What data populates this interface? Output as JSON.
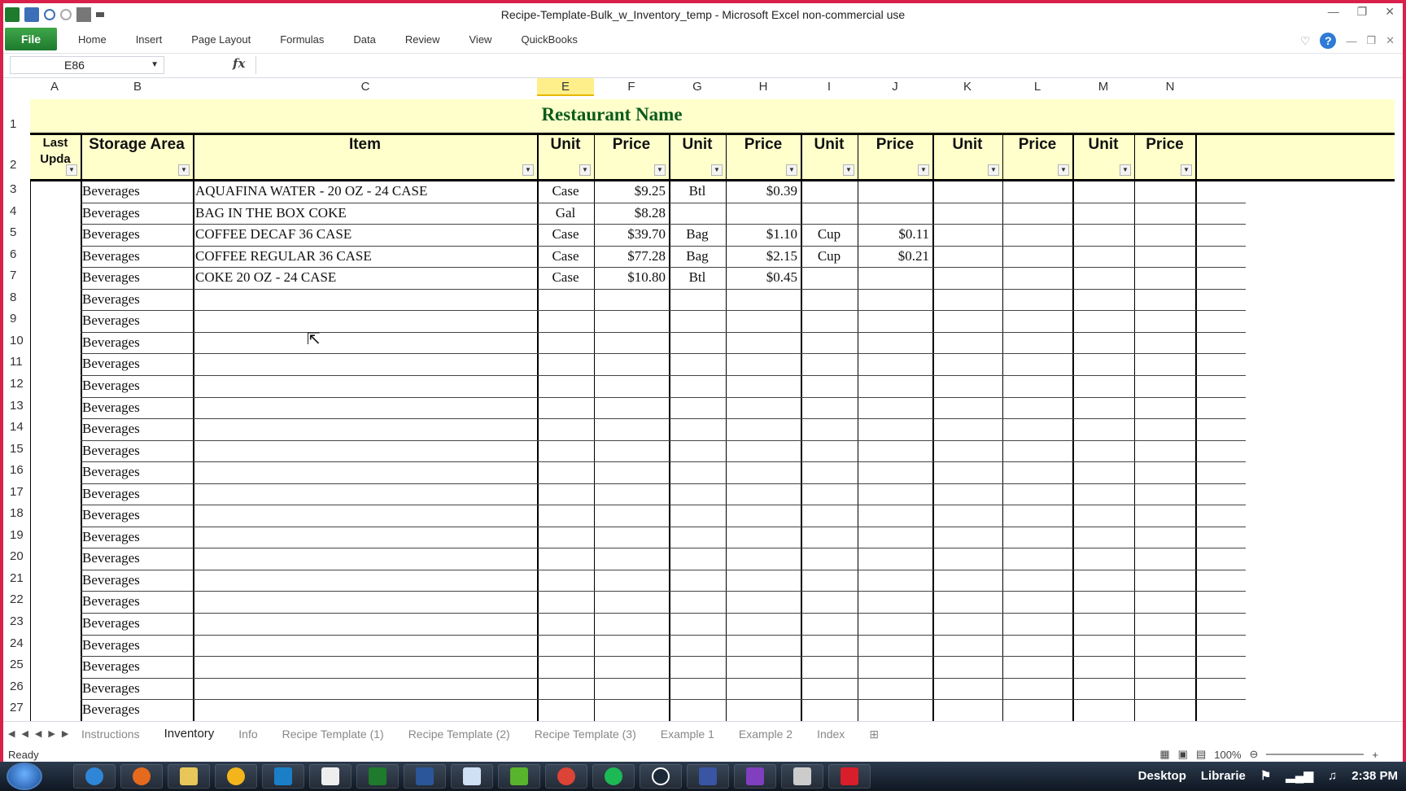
{
  "window": {
    "title": "Recipe-Template-Bulk_w_Inventory_temp  -  Microsoft Excel non-commercial use"
  },
  "ribbon": {
    "file_label": "File",
    "tabs": [
      "Home",
      "Insert",
      "Page Layout",
      "Formulas",
      "Data",
      "Review",
      "View",
      "QuickBooks"
    ]
  },
  "formula_bar": {
    "name_box": "E86",
    "fx_label": "fx",
    "value": ""
  },
  "columns": [
    "A",
    "B",
    "C",
    "E",
    "F",
    "G",
    "H",
    "I",
    "J",
    "K",
    "L",
    "M",
    "N"
  ],
  "selected_column": "E",
  "sheet": {
    "title": "Restaurant Name",
    "headers": {
      "last_update": "Last Upda",
      "storage_area": "Storage Area",
      "item": "Item",
      "unit": "Unit",
      "price": "Price"
    },
    "rows": [
      {
        "n": "1"
      },
      {
        "n": "2"
      },
      {
        "n": "3",
        "area": "Beverages",
        "item": "AQUAFINA WATER - 20 OZ - 24 CASE",
        "u1": "Case",
        "p1": "$9.25",
        "u2": "Btl",
        "p2": "$0.39",
        "u3": "",
        "p3": ""
      },
      {
        "n": "4",
        "area": "Beverages",
        "item": "BAG IN THE BOX COKE",
        "u1": "Gal",
        "p1": "$8.28",
        "u2": "",
        "p2": "",
        "u3": "",
        "p3": ""
      },
      {
        "n": "5",
        "area": "Beverages",
        "item": "COFFEE DECAF 36 CASE",
        "u1": "Case",
        "p1": "$39.70",
        "u2": "Bag",
        "p2": "$1.10",
        "u3": "Cup",
        "p3": "$0.11"
      },
      {
        "n": "6",
        "area": "Beverages",
        "item": "COFFEE REGULAR 36 CASE",
        "u1": "Case",
        "p1": "$77.28",
        "u2": "Bag",
        "p2": "$2.15",
        "u3": "Cup",
        "p3": "$0.21"
      },
      {
        "n": "7",
        "area": "Beverages",
        "item": "COKE 20 OZ - 24 CASE",
        "u1": "Case",
        "p1": "$10.80",
        "u2": "Btl",
        "p2": "$0.45",
        "u3": "",
        "p3": ""
      },
      {
        "n": "8",
        "area": "Beverages"
      },
      {
        "n": "9",
        "area": "Beverages"
      },
      {
        "n": "10",
        "area": "Beverages"
      },
      {
        "n": "11",
        "area": "Beverages"
      },
      {
        "n": "12",
        "area": "Beverages"
      },
      {
        "n": "13",
        "area": "Beverages"
      },
      {
        "n": "14",
        "area": "Beverages"
      },
      {
        "n": "15",
        "area": "Beverages"
      },
      {
        "n": "16",
        "area": "Beverages"
      },
      {
        "n": "17",
        "area": "Beverages"
      },
      {
        "n": "18",
        "area": "Beverages"
      },
      {
        "n": "19",
        "area": "Beverages"
      },
      {
        "n": "20",
        "area": "Beverages"
      },
      {
        "n": "21",
        "area": "Beverages"
      },
      {
        "n": "22",
        "area": "Beverages"
      },
      {
        "n": "23",
        "area": "Beverages"
      },
      {
        "n": "24",
        "area": "Beverages"
      },
      {
        "n": "25",
        "area": "Beverages"
      },
      {
        "n": "26",
        "area": "Beverages"
      },
      {
        "n": "27",
        "area": "Beverages"
      }
    ]
  },
  "sheet_tabs": [
    "Instructions",
    "Inventory",
    "Info",
    "Recipe Template (1)",
    "Recipe Template (2)",
    "Recipe Template (3)",
    "Example 1",
    "Example 2",
    "Index"
  ],
  "active_sheet": "Inventory",
  "status": {
    "ready": "Ready",
    "zoom": "100%"
  },
  "taskbar": {
    "desktop_label": "Desktop",
    "libraries_label": "Librarie",
    "clock": "2:38 PM"
  },
  "colors": {
    "header_fill": "#ffffcc",
    "title_green": "#0b5b1b",
    "file_tab_green": "#2e8b3c",
    "selected_col": "#ffef8a",
    "window_border": "#d8204a"
  }
}
